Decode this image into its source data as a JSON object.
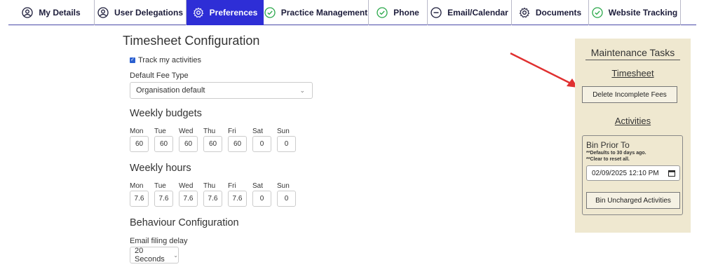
{
  "nav": {
    "tabs": [
      {
        "label": "My Details",
        "icon": "user-circle-icon"
      },
      {
        "label": "User Delegations",
        "icon": "user-circle-icon"
      },
      {
        "label": "Preferences",
        "icon": "gear-icon",
        "active": true
      },
      {
        "label": "Practice Management",
        "icon": "check-circle-icon"
      },
      {
        "label": "Phone",
        "icon": "check-circle-icon"
      },
      {
        "label": "Email/Calendar",
        "icon": "minus-circle-icon"
      },
      {
        "label": "Documents",
        "icon": "gear-icon"
      },
      {
        "label": "Website Tracking",
        "icon": "check-circle-icon"
      }
    ],
    "active_color": "#2e2ed6"
  },
  "timesheet": {
    "title": "Timesheet Configuration",
    "track_label": "Track my activities",
    "track_checked": true,
    "fee_type_label": "Default Fee Type",
    "fee_type_value": "Organisation default"
  },
  "budgets": {
    "title": "Weekly budgets",
    "days": [
      "Mon",
      "Tue",
      "Wed",
      "Thu",
      "Fri",
      "Sat",
      "Sun"
    ],
    "values": [
      "60",
      "60",
      "60",
      "60",
      "60",
      "0",
      "0"
    ]
  },
  "hours": {
    "title": "Weekly hours",
    "days": [
      "Mon",
      "Tue",
      "Wed",
      "Thu",
      "Fri",
      "Sat",
      "Sun"
    ],
    "values": [
      "7.6",
      "7.6",
      "7.6",
      "7.6",
      "7.6",
      "0",
      "0"
    ]
  },
  "behaviour": {
    "title": "Behaviour Configuration",
    "delay_label": "Email filing delay",
    "delay_value": "20 Seconds"
  },
  "maintenance": {
    "title": "Maintenance Tasks",
    "timesheet_heading": "Timesheet",
    "delete_button": "Delete Incomplete Fees",
    "activities_heading": "Activities",
    "bin_title": "Bin Prior To",
    "note1": "**Defaults to 30 days ago.",
    "note2": "**Clear to reset all.",
    "date_value": "02/09/2025 12:10 PM",
    "bin_button": "Bin Uncharged Activities",
    "panel_color": "#efe8d0",
    "arrow_color": "#e03030"
  }
}
